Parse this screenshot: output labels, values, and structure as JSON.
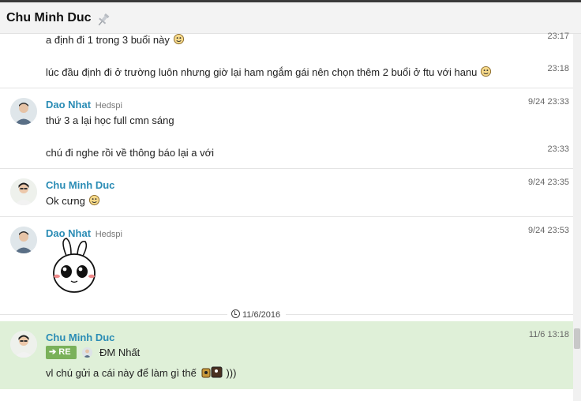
{
  "header": {
    "title": "Chu Minh Duc"
  },
  "messages": {
    "m1": {
      "text": "a định đi 1 trong 3 buổi này",
      "time": "23:17"
    },
    "m2": {
      "text": "lúc đầu định đi ở trường luôn nhưng giờ lại ham ngắm gái nên chọn thêm 2 buổi ở ftu với hanu",
      "time": "23:18"
    },
    "g1": {
      "name": "Dao Nhat",
      "org": "Hedspi",
      "time": "9/24 23:33",
      "line1": "thứ 3 a lại học full cmn sáng",
      "line2": "chú đi nghe rồi về thông báo lại a với",
      "time2": "23:33"
    },
    "g2": {
      "name": "Chu Minh Duc",
      "time": "9/24 23:35",
      "line1": "Ok cưng"
    },
    "g3": {
      "name": "Dao Nhat",
      "org": "Hedspi",
      "time": "9/24 23:53"
    },
    "date_divider": "11/6/2016",
    "g4": {
      "name": "Chu Minh Duc",
      "time": "11/6 13:18",
      "re_label": "RE",
      "reply_to": "ĐM Nhất",
      "line1": "vl chú gửi a cái này để làm gì thế",
      "line1_suffix": ")))"
    }
  },
  "icons": [
    "pin-icon",
    "smiley-icon",
    "clock-icon",
    "arrow-right-icon"
  ],
  "colors": {
    "name": "#2a8cb5",
    "highlight": "#dff0d8",
    "re_badge": "#7ab15a"
  }
}
